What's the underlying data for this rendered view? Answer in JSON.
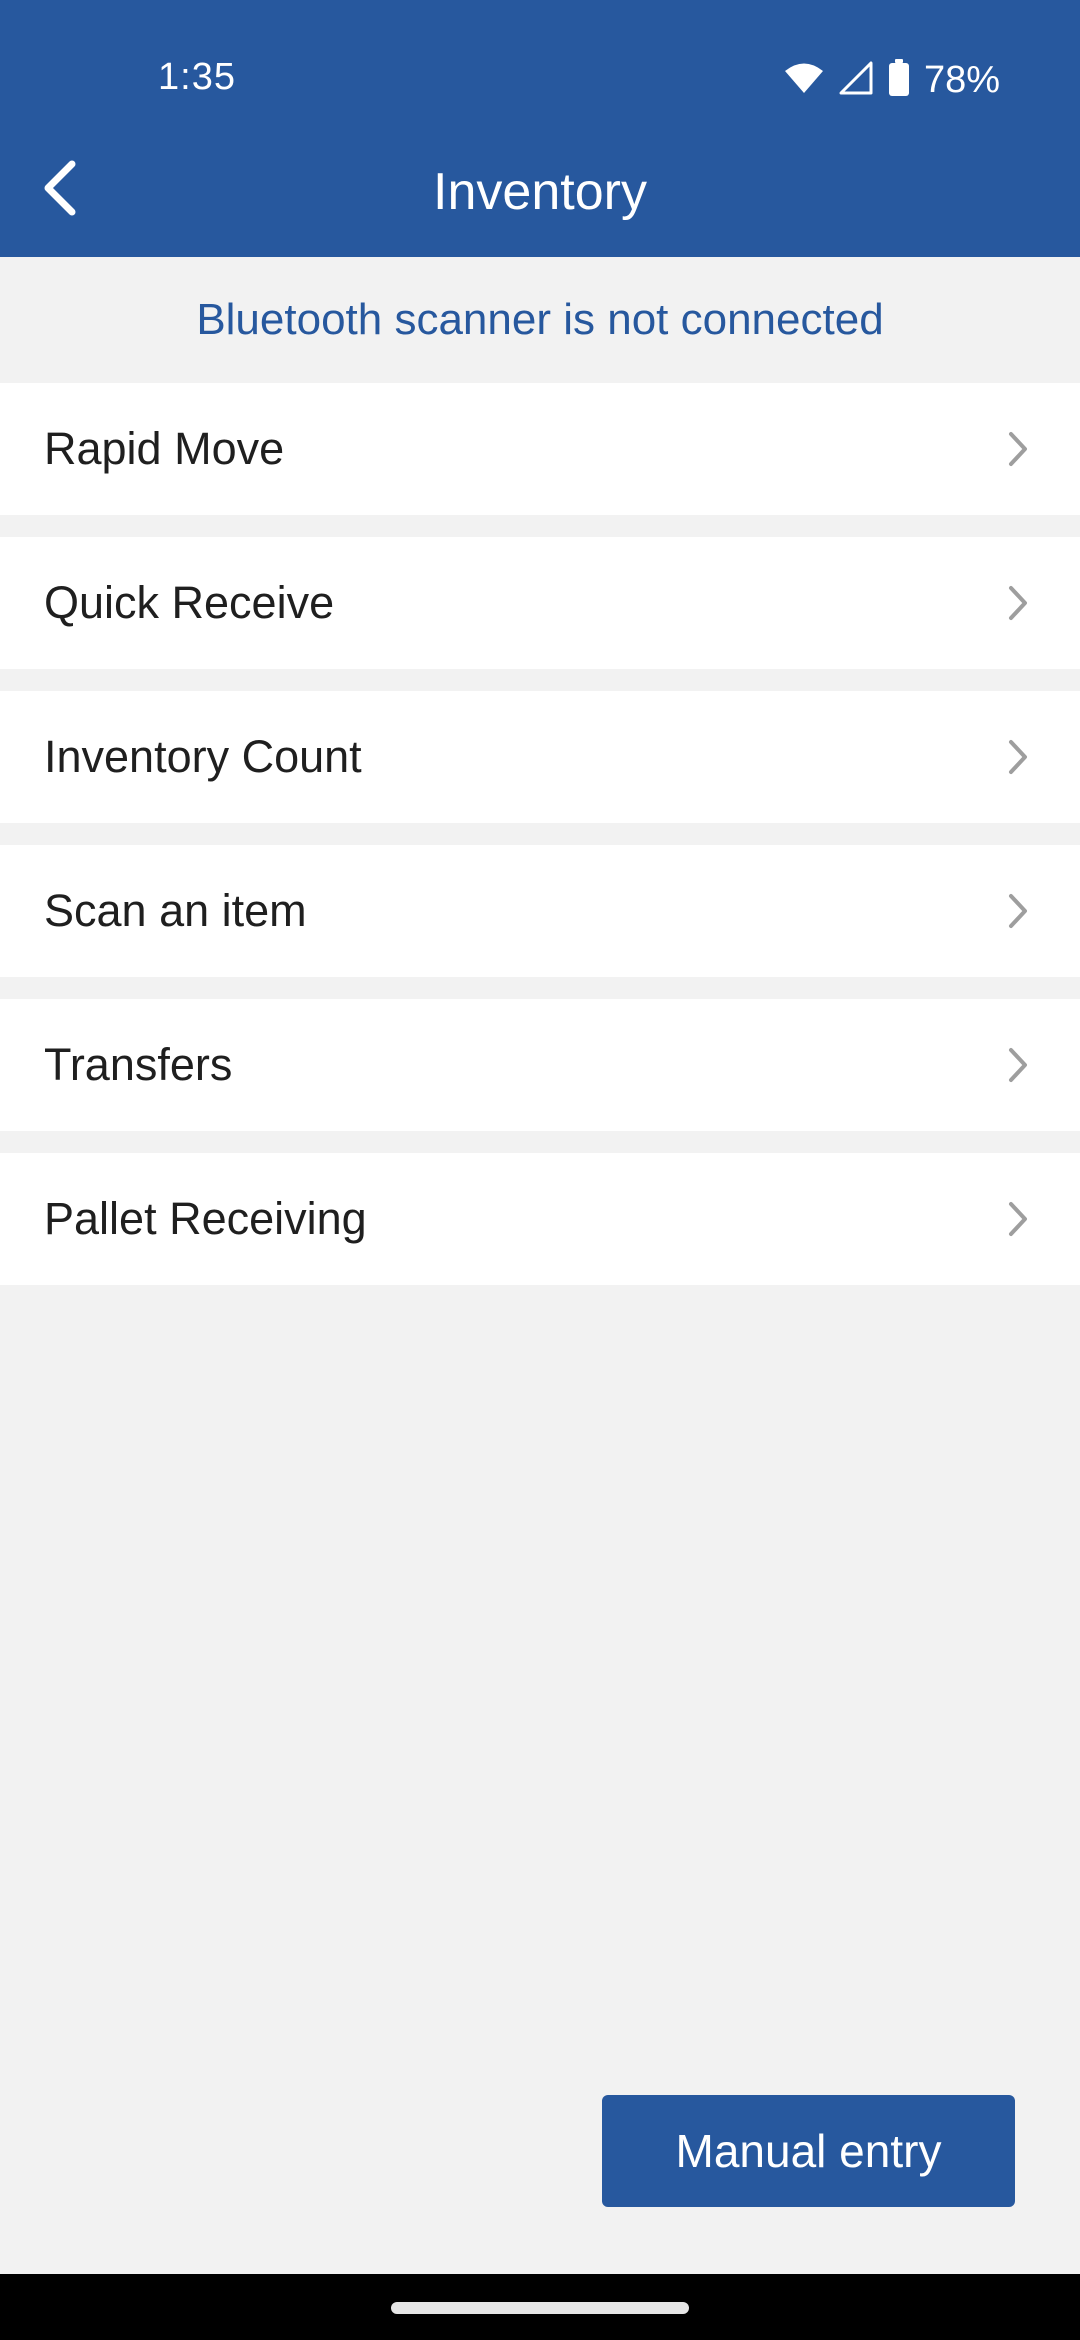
{
  "status_bar": {
    "time": "1:35",
    "battery": "78%",
    "icons": [
      "wifi-icon",
      "cellular-signal-icon",
      "battery-icon"
    ]
  },
  "app_bar": {
    "title": "Inventory",
    "back_icon": "chevron-left-icon"
  },
  "banner": {
    "text": "Bluetooth scanner is not connected"
  },
  "menu": {
    "items": [
      {
        "label": "Rapid Move"
      },
      {
        "label": "Quick Receive"
      },
      {
        "label": "Inventory Count"
      },
      {
        "label": "Scan an item"
      },
      {
        "label": "Transfers"
      },
      {
        "label": "Pallet Receiving"
      }
    ],
    "chevron_icon": "chevron-right-icon"
  },
  "actions": {
    "manual_entry_label": "Manual entry"
  },
  "colors": {
    "primary": "#27589e",
    "background": "#f2f2f2",
    "item_background": "#ffffff",
    "item_text": "#1f1f1f",
    "chevron": "#9e9e9e"
  }
}
